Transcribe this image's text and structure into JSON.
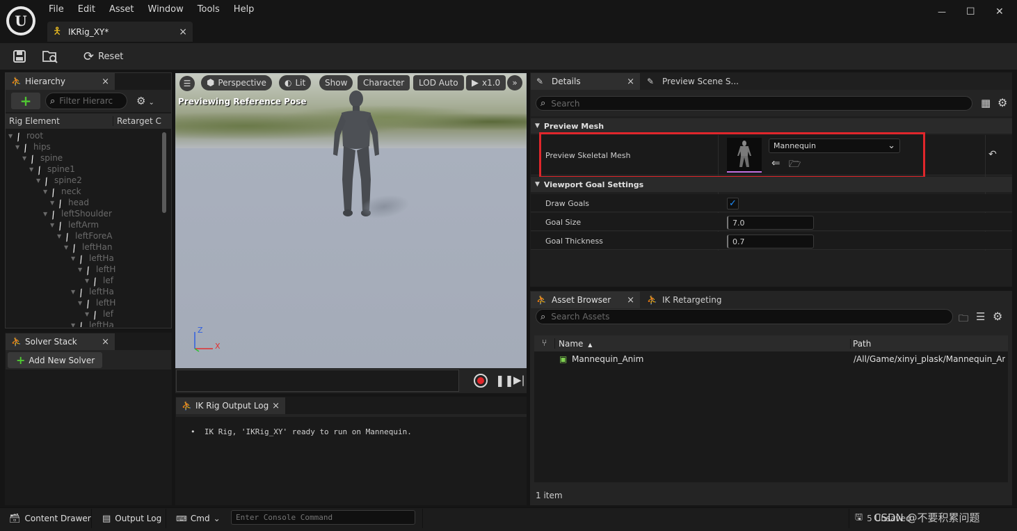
{
  "menu": [
    "File",
    "Edit",
    "Asset",
    "Window",
    "Tools",
    "Help"
  ],
  "doc_tab": {
    "label": "IKRig_XY*",
    "close": "×"
  },
  "window_controls": {
    "minimize": "—",
    "maximize": "☐",
    "close": "✕"
  },
  "toolbar": {
    "reset_label": "Reset"
  },
  "hierarchy": {
    "tab_label": "Hierarchy",
    "filter_placeholder": "Filter Hierarc",
    "col_rig_element": "Rig Element",
    "col_retarget": "Retarget C",
    "items": [
      {
        "label": "root",
        "depth": 0
      },
      {
        "label": "hips",
        "depth": 1
      },
      {
        "label": "spine",
        "depth": 2
      },
      {
        "label": "spine1",
        "depth": 3
      },
      {
        "label": "spine2",
        "depth": 4
      },
      {
        "label": "neck",
        "depth": 5
      },
      {
        "label": "head",
        "depth": 6
      },
      {
        "label": "leftShoulder",
        "depth": 5
      },
      {
        "label": "leftArm",
        "depth": 6
      },
      {
        "label": "leftForeA",
        "depth": 7
      },
      {
        "label": "leftHan",
        "depth": 8
      },
      {
        "label": "leftHa",
        "depth": 9
      },
      {
        "label": "leftH",
        "depth": 10
      },
      {
        "label": "lef",
        "depth": 11
      },
      {
        "label": "leftHa",
        "depth": 9
      },
      {
        "label": "leftH",
        "depth": 10
      },
      {
        "label": "lef",
        "depth": 11
      },
      {
        "label": "leftHa",
        "depth": 9
      }
    ]
  },
  "solver_stack": {
    "tab_label": "Solver Stack",
    "add_label": "Add New Solver"
  },
  "viewport": {
    "perspective": "Perspective",
    "lit": "Lit",
    "show": "Show",
    "character": "Character",
    "lod": "LOD Auto",
    "speed": "x1.0",
    "overlay": "Previewing Reference Pose",
    "axis_z": "Z",
    "axis_x": "X"
  },
  "output_log": {
    "tab_label": "IK Rig Output Log",
    "message": "IK Rig, 'IKRig_XY' ready to run on Mannequin."
  },
  "details": {
    "tab_label": "Details",
    "tab2_label": "Preview Scene S...",
    "search_placeholder": "Search",
    "section_preview": "Preview Mesh",
    "preview_skeletal_mesh": "Preview Skeletal Mesh",
    "mesh_value": "Mannequin",
    "section_goal": "Viewport Goal Settings",
    "draw_goals": "Draw Goals",
    "goal_size": "Goal Size",
    "goal_size_value": "7.0",
    "goal_thickness": "Goal Thickness",
    "goal_thickness_value": "0.7"
  },
  "asset_browser": {
    "tab_label": "Asset Browser",
    "tab2_label": "IK Retargeting",
    "search_placeholder": "Search Assets",
    "col_name": "Name",
    "col_path": "Path",
    "rows": [
      {
        "name": "Mannequin_Anim",
        "path": "/All/Game/xinyi_plask/Mannequin_An"
      }
    ],
    "count": "1 item"
  },
  "statusbar": {
    "content_drawer": "Content Drawer",
    "output_log": "Output Log",
    "cmd": "Cmd",
    "console_placeholder": "Enter Console Command",
    "source_control": "5 Unsaved",
    "watermark": "CSDN @不要积累问题"
  },
  "colors": {
    "highlight": "#e0262b",
    "accent": "#0070e0",
    "viewport_floor": "#9aa2b0"
  }
}
